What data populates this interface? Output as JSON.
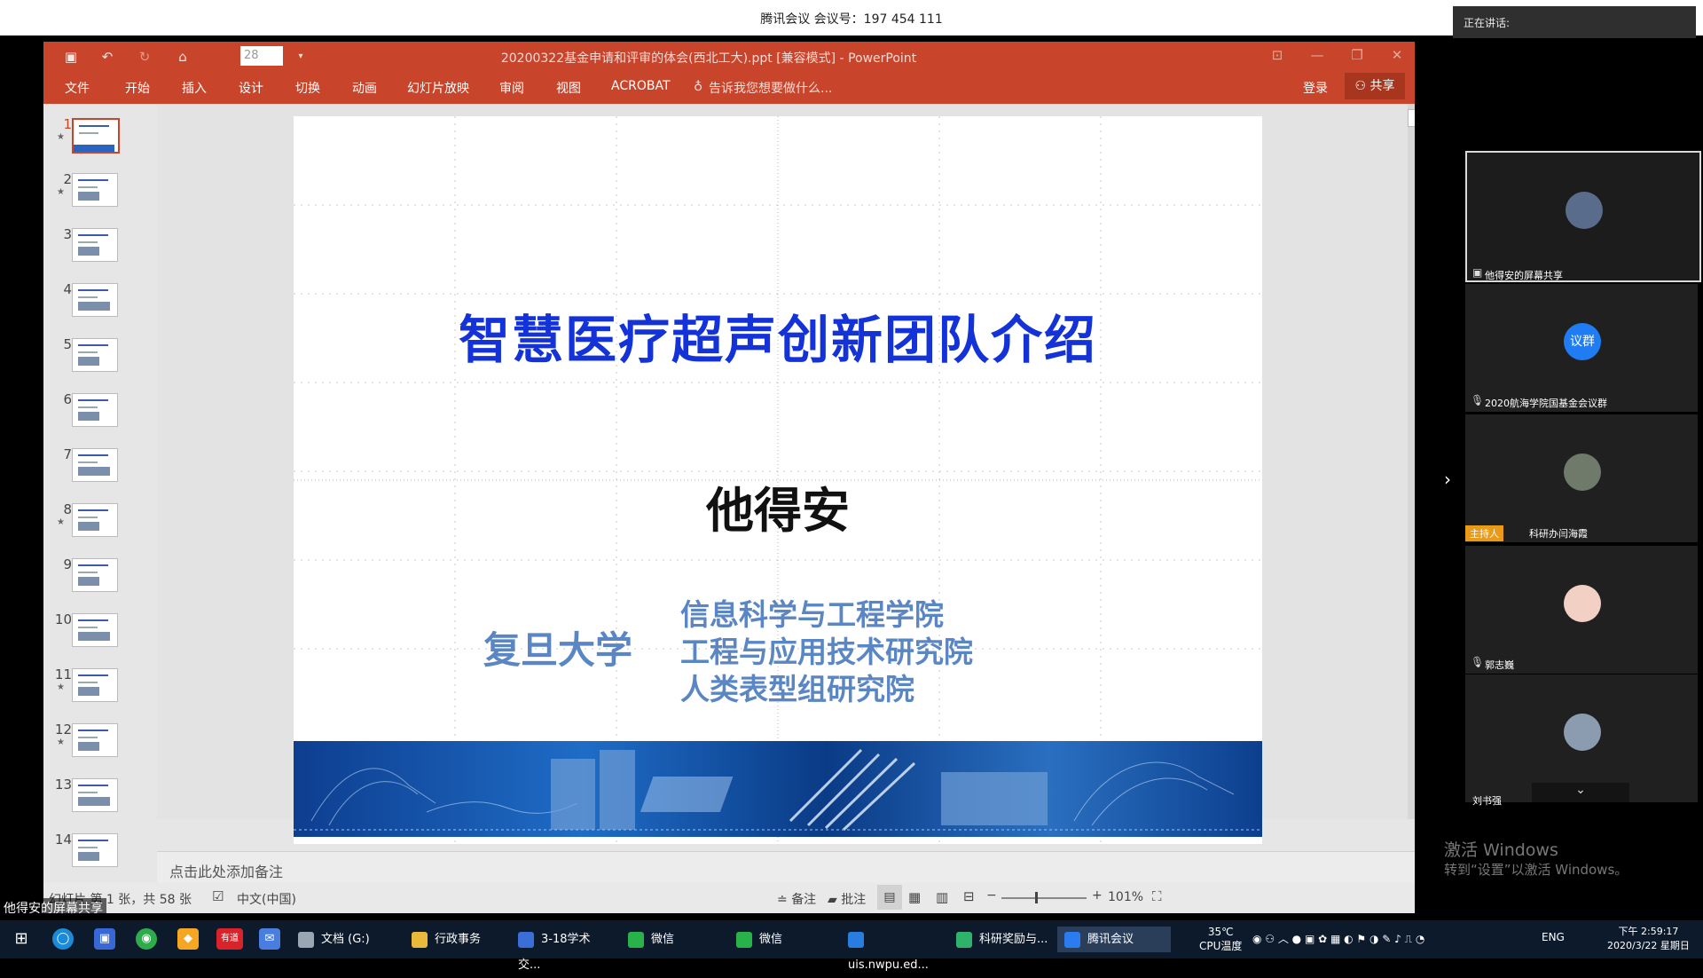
{
  "meeting": {
    "title": "腾讯会议 会议号：197 454 111",
    "speaking_label": "正在讲话:",
    "participants": [
      {
        "name": "他得安的屏幕共享",
        "avatar_text": "",
        "avatar_color": "#5a6c8c"
      },
      {
        "name": "2020航海学院国基金会议群",
        "avatar_text": "议群",
        "avatar_color": "#1f7cf2"
      },
      {
        "name": "科研办闫海霞",
        "badge": "主持人",
        "avatar_text": "",
        "avatar_color": "#6f7a6a"
      },
      {
        "name": "郭志巍",
        "avatar_text": "",
        "avatar_color": "#f2d0c4"
      },
      {
        "name": "刘书强",
        "avatar_text": "",
        "avatar_color": "#8c9cb0"
      }
    ],
    "activate_windows_title": "激活 Windows",
    "activate_windows_sub": "转到“设置”以激活 Windows。",
    "share_indicator": "他得安的屏幕共享"
  },
  "powerpoint": {
    "window_title": "20200322基金申请和评审的体会(西北工大).ppt [兼容模式] - PowerPoint",
    "font_size": "28",
    "tabs": [
      "文件",
      "开始",
      "插入",
      "设计",
      "切换",
      "动画",
      "幻灯片放映",
      "审阅",
      "视图",
      "ACROBAT"
    ],
    "tell_me": "告诉我您想要做什么...",
    "login": "登录",
    "share": "共享",
    "thumbnails": [
      "1",
      "2",
      "3",
      "4",
      "5",
      "6",
      "7",
      "8",
      "9",
      "10",
      "11",
      "12",
      "13",
      "14"
    ],
    "notes_placeholder": "点击此处添加备注",
    "status": {
      "slide_info": "幻灯片 第 1 张，共 58 张",
      "language": "中文(中国)",
      "notes": "备注",
      "comments": "批注",
      "zoom": "101%"
    }
  },
  "slide": {
    "title": "智慧医疗超声创新团队介绍",
    "author": "他得安",
    "university": "复旦大学",
    "institutes": [
      "信息科学与工程学院",
      "工程与应用技术研究院",
      "人类表型组研究院"
    ]
  },
  "taskbar": {
    "apps": [
      {
        "label": "文档 (G:)",
        "color": "#9aa6b4"
      },
      {
        "label": "行政事务",
        "color": "#e8b93a"
      },
      {
        "label": "3-18学术交...",
        "color": "#3a6fd8"
      },
      {
        "label": "微信",
        "color": "#2ab24a"
      },
      {
        "label": "微信",
        "color": "#2ab24a"
      },
      {
        "label": "uis.nwpu.ed...",
        "color": "#2a7de0"
      },
      {
        "label": "科研奖励与...",
        "color": "#2fb36a"
      },
      {
        "label": "腾讯会议",
        "color": "#2b7cf0"
      }
    ],
    "temperature": "35℃",
    "cpu_label": "CPU温度",
    "input_lang": "ENG",
    "time": "下午 2:59:17",
    "date": "2020/3/22 星期日",
    "pinned_labels": [
      "有道"
    ]
  }
}
